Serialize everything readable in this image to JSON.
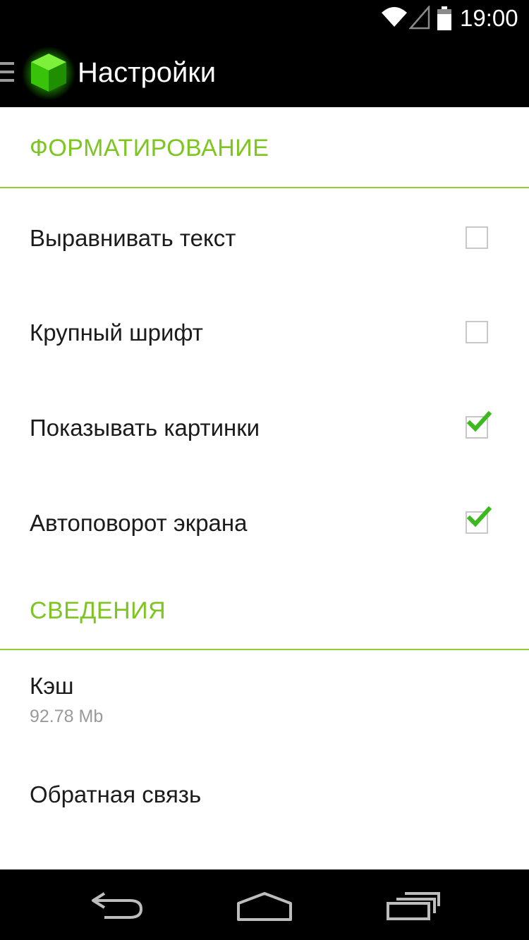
{
  "status_bar": {
    "time": "19:00",
    "icons": [
      "wifi-icon",
      "signal-icon",
      "battery-icon"
    ]
  },
  "action_bar": {
    "title": "Настройки",
    "icons": [
      "drawer-icon",
      "app-logo-icon"
    ]
  },
  "sections": [
    {
      "header": "ФОРМАТИРОВАНИЕ",
      "items": [
        {
          "title": "Выравнивать текст",
          "checked": false
        },
        {
          "title": "Крупный шрифт",
          "checked": false
        },
        {
          "title": "Показывать картинки",
          "checked": true
        },
        {
          "title": "Автоповорот экрана",
          "checked": true
        }
      ]
    },
    {
      "header": "СВЕДЕНИЯ",
      "items": [
        {
          "title": "Кэш",
          "summary": "92.78 Mb"
        },
        {
          "title": "Обратная связь"
        }
      ]
    }
  ],
  "nav_bar": {
    "icons": [
      "back-icon",
      "home-icon",
      "recent-apps-icon"
    ]
  },
  "colors": {
    "accent": "#7dc621",
    "divider": "#8fcf33",
    "check": "#3cb91e",
    "bar_background": "#000000"
  }
}
